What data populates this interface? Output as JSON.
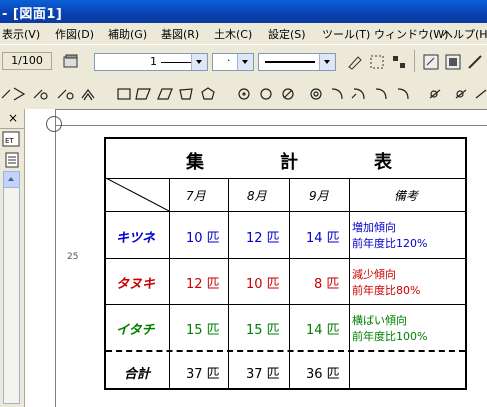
{
  "window": {
    "title": "- [図面1]"
  },
  "menu": [
    "表示(V)",
    "作図(D)",
    "補助(G)",
    "基図(R)",
    "土木(C)",
    "設定(S)",
    "ツール(T)",
    "ウィンドウ(W)",
    "ヘルプ(H)"
  ],
  "toolbar": {
    "scale": "1/100",
    "line_width": "1",
    "line_style": "·",
    "ruler_label": "25"
  },
  "left_panel": {
    "close": "×"
  },
  "table": {
    "title_chars": [
      "集",
      "計",
      "表"
    ],
    "columns": [
      "7月",
      "8月",
      "9月",
      "備考"
    ],
    "rows": [
      {
        "label": "キツネ",
        "values": [
          "10 匹",
          "12 匹",
          "14 匹"
        ],
        "note_lines": [
          "増加傾向",
          "前年度比120%"
        ],
        "color": "#0000cc"
      },
      {
        "label": "タヌキ",
        "values": [
          "12 匹",
          "10 匹",
          "8 匹"
        ],
        "note_lines": [
          "減少傾向",
          "前年度比80%"
        ],
        "color": "#cc0000"
      },
      {
        "label": "イタチ",
        "values": [
          "15 匹",
          "15 匹",
          "14 匹"
        ],
        "note_lines": [
          "横ばい傾向",
          "前年度比100%"
        ],
        "color": "#008000"
      }
    ],
    "total": {
      "label": "合計",
      "values": [
        "37 匹",
        "37 匹",
        "36 匹"
      ]
    }
  }
}
